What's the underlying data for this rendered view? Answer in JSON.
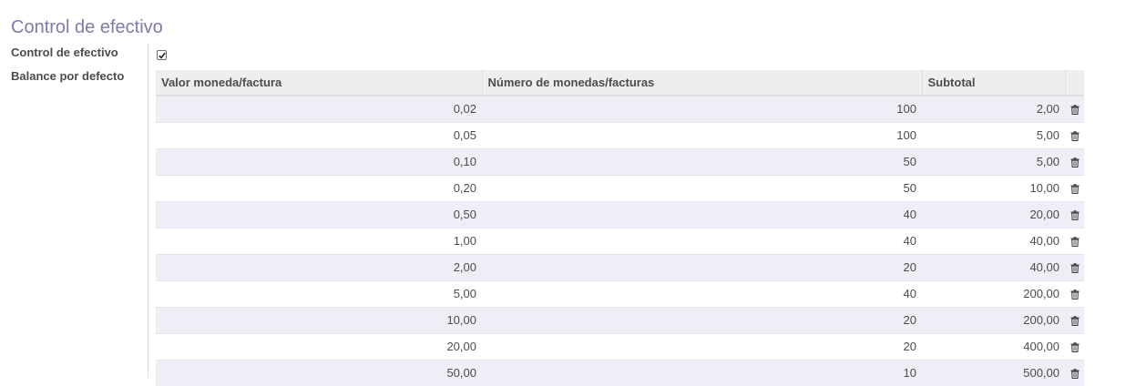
{
  "section": {
    "title": "Control de efectivo"
  },
  "fields": {
    "cash_control_label": "Control de efectivo",
    "cash_control_checked": true,
    "default_balance_label": "Balance por defecto"
  },
  "table": {
    "headers": [
      "Valor moneda/factura",
      "Número de monedas/facturas",
      "Subtotal"
    ],
    "rows": [
      {
        "value": "0,02",
        "count": "100",
        "subtotal": "2,00"
      },
      {
        "value": "0,05",
        "count": "100",
        "subtotal": "5,00"
      },
      {
        "value": "0,10",
        "count": "50",
        "subtotal": "5,00"
      },
      {
        "value": "0,20",
        "count": "50",
        "subtotal": "10,00"
      },
      {
        "value": "0,50",
        "count": "40",
        "subtotal": "20,00"
      },
      {
        "value": "1,00",
        "count": "40",
        "subtotal": "40,00"
      },
      {
        "value": "2,00",
        "count": "20",
        "subtotal": "40,00"
      },
      {
        "value": "5,00",
        "count": "40",
        "subtotal": "200,00"
      },
      {
        "value": "10,00",
        "count": "20",
        "subtotal": "200,00"
      },
      {
        "value": "20,00",
        "count": "20",
        "subtotal": "400,00"
      },
      {
        "value": "50,00",
        "count": "10",
        "subtotal": "500,00"
      }
    ],
    "row_action_icon": "trash-icon"
  }
}
